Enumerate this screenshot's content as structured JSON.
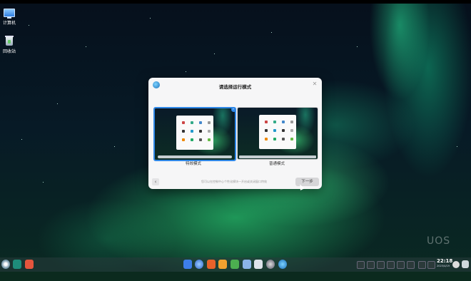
{
  "desktop": {
    "icons": [
      {
        "label": "计算机",
        "icon": "computer-icon"
      },
      {
        "label": "回收站",
        "icon": "trash-icon"
      }
    ],
    "brand": "UOS"
  },
  "dialog": {
    "title": "请选择运行模式",
    "modes": [
      {
        "label": "特效模式",
        "selected": true
      },
      {
        "label": "普通模式",
        "selected": false
      }
    ],
    "hint": "您可以在控制中心个性化模块一开启或关闭窗口特效",
    "next_label": "下一步",
    "accent": "#2f88e8"
  },
  "taskbar": {
    "clock_time": "22:18",
    "clock_date": "2023/4/19"
  }
}
